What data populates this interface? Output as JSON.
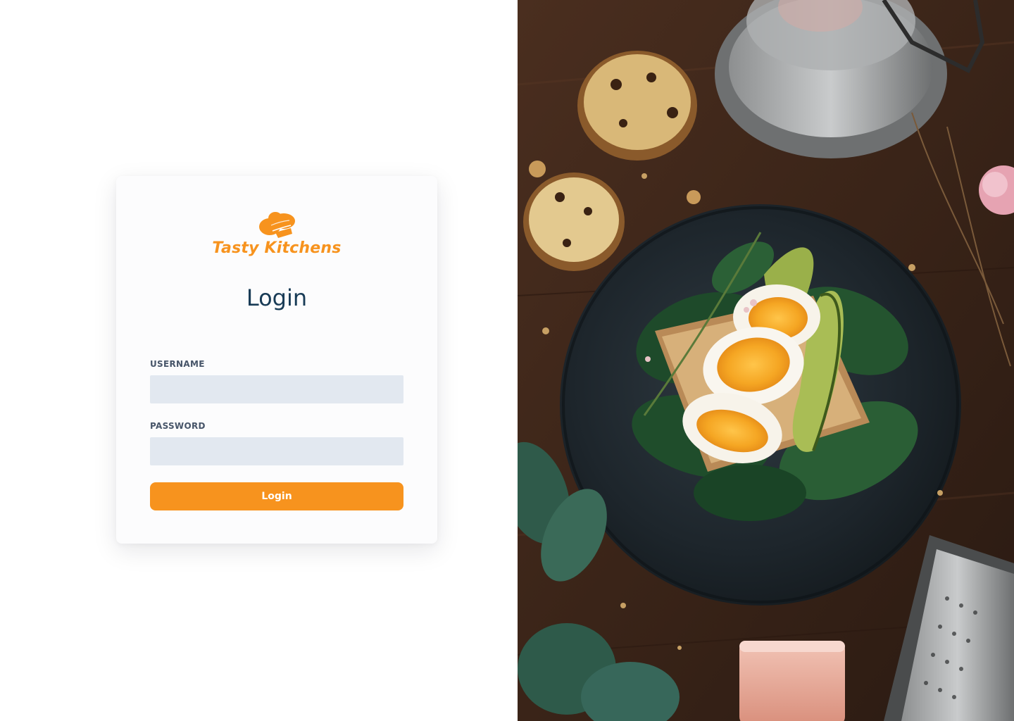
{
  "brand": {
    "name": "Tasty Kitchens",
    "color": "#f7931e",
    "icon": "chef-hat-icon"
  },
  "login": {
    "heading": "Login",
    "username_label": "USERNAME",
    "username_value": "",
    "password_label": "PASSWORD",
    "password_value": "",
    "button_label": "Login"
  },
  "hero_image": {
    "subject": "food-photo"
  },
  "colors": {
    "accent": "#f7931e",
    "input_bg": "#e2e8f0",
    "heading": "#183b56",
    "label": "#475569"
  }
}
